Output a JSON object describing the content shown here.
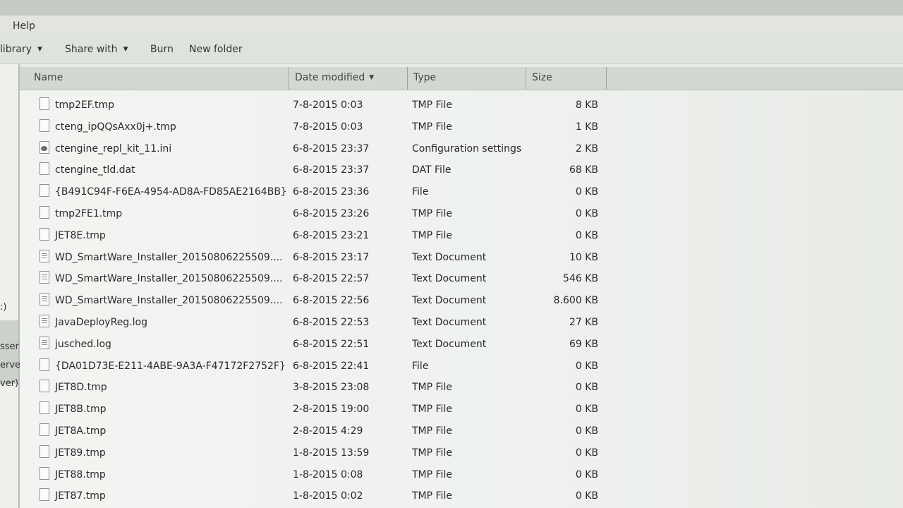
{
  "menu": {
    "help_label": "Help"
  },
  "toolbar": {
    "library_label": "library",
    "share_label": "Share with",
    "burn_label": "Burn",
    "new_folder_label": "New folder"
  },
  "sidebar": {
    "items": [
      ":)",
      "sser",
      "erve",
      "ver)"
    ]
  },
  "columns": {
    "name": "Name",
    "date": "Date modified",
    "type": "Type",
    "size": "Size"
  },
  "files": [
    {
      "name": "tmp2EF.tmp",
      "date": "7-8-2015 0:03",
      "type": "TMP File",
      "size": "8 KB",
      "icon": "blank-file-icon"
    },
    {
      "name": "cteng_ipQQsAxx0j+.tmp",
      "date": "7-8-2015 0:03",
      "type": "TMP File",
      "size": "1 KB",
      "icon": "blank-file-icon"
    },
    {
      "name": "ctengine_repl_kit_11.ini",
      "date": "6-8-2015 23:37",
      "type": "Configuration settings",
      "size": "2 KB",
      "icon": "config-file-icon"
    },
    {
      "name": "ctengine_tld.dat",
      "date": "6-8-2015 23:37",
      "type": "DAT File",
      "size": "68 KB",
      "icon": "blank-file-icon"
    },
    {
      "name": "{B491C94F-F6EA-4954-AD8A-FD85AE2164BB}",
      "date": "6-8-2015 23:36",
      "type": "File",
      "size": "0 KB",
      "icon": "blank-file-icon"
    },
    {
      "name": "tmp2FE1.tmp",
      "date": "6-8-2015 23:26",
      "type": "TMP File",
      "size": "0 KB",
      "icon": "blank-file-icon"
    },
    {
      "name": "JET8E.tmp",
      "date": "6-8-2015 23:21",
      "type": "TMP File",
      "size": "0 KB",
      "icon": "blank-file-icon"
    },
    {
      "name": "WD_SmartWare_Installer_20150806225509....",
      "date": "6-8-2015 23:17",
      "type": "Text Document",
      "size": "10 KB",
      "icon": "text-file-icon"
    },
    {
      "name": "WD_SmartWare_Installer_20150806225509....",
      "date": "6-8-2015 22:57",
      "type": "Text Document",
      "size": "546 KB",
      "icon": "text-file-icon"
    },
    {
      "name": "WD_SmartWare_Installer_20150806225509....",
      "date": "6-8-2015 22:56",
      "type": "Text Document",
      "size": "8.600 KB",
      "icon": "text-file-icon"
    },
    {
      "name": "JavaDeployReg.log",
      "date": "6-8-2015 22:53",
      "type": "Text Document",
      "size": "27 KB",
      "icon": "text-file-icon"
    },
    {
      "name": "jusched.log",
      "date": "6-8-2015 22:51",
      "type": "Text Document",
      "size": "69 KB",
      "icon": "text-file-icon"
    },
    {
      "name": "{DA01D73E-E211-4ABE-9A3A-F47172F2752F}",
      "date": "6-8-2015 22:41",
      "type": "File",
      "size": "0 KB",
      "icon": "blank-file-icon"
    },
    {
      "name": "JET8D.tmp",
      "date": "3-8-2015 23:08",
      "type": "TMP File",
      "size": "0 KB",
      "icon": "blank-file-icon"
    },
    {
      "name": "JET8B.tmp",
      "date": "2-8-2015 19:00",
      "type": "TMP File",
      "size": "0 KB",
      "icon": "blank-file-icon"
    },
    {
      "name": "JET8A.tmp",
      "date": "2-8-2015 4:29",
      "type": "TMP File",
      "size": "0 KB",
      "icon": "blank-file-icon"
    },
    {
      "name": "JET89.tmp",
      "date": "1-8-2015 13:59",
      "type": "TMP File",
      "size": "0 KB",
      "icon": "blank-file-icon"
    },
    {
      "name": "JET88.tmp",
      "date": "1-8-2015 0:08",
      "type": "TMP File",
      "size": "0 KB",
      "icon": "blank-file-icon"
    },
    {
      "name": "JET87.tmp",
      "date": "1-8-2015 0:02",
      "type": "TMP File",
      "size": "0 KB",
      "icon": "blank-file-icon"
    }
  ]
}
